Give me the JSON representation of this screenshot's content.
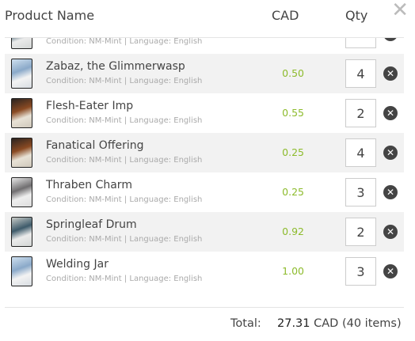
{
  "header": {
    "product_name": "Product Name",
    "currency": "CAD",
    "qty": "Qty",
    "close_icon": "close-icon"
  },
  "partial_row": {
    "condition": "Condition: NM-Mint | Language: English"
  },
  "items": [
    {
      "name": "Zabaz, the Glimmerwasp",
      "condition": "Condition: NM-Mint | Language: English",
      "price": "0.50",
      "qty": "4"
    },
    {
      "name": "Flesh-Eater Imp",
      "condition": "Condition: NM-Mint | Language: English",
      "price": "0.55",
      "qty": "2"
    },
    {
      "name": "Fanatical Offering",
      "condition": "Condition: NM-Mint | Language: English",
      "price": "0.25",
      "qty": "4"
    },
    {
      "name": "Thraben Charm",
      "condition": "Condition: NM-Mint | Language: English",
      "price": "0.25",
      "qty": "3"
    },
    {
      "name": "Springleaf Drum",
      "condition": "Condition: NM-Mint | Language: English",
      "price": "0.92",
      "qty": "2"
    },
    {
      "name": "Welding Jar",
      "condition": "Condition: NM-Mint | Language: English",
      "price": "1.00",
      "qty": "3"
    }
  ],
  "footer": {
    "label": "Total:",
    "amount": "27.31",
    "suffix": "CAD (40 items)"
  },
  "colors": {
    "price": "#8dbb2c",
    "alt_row": "#f2f2f2"
  }
}
